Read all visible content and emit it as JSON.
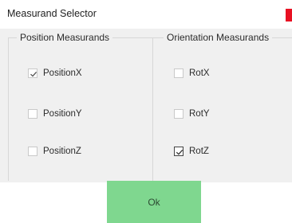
{
  "window": {
    "title": "Measurand Selector"
  },
  "position_group": {
    "title": "Position Measurands",
    "items": [
      {
        "label": "PositionX",
        "checked": true
      },
      {
        "label": "PositionY",
        "checked": false
      },
      {
        "label": "PositionZ",
        "checked": false
      }
    ]
  },
  "orientation_group": {
    "title": "Orientation Measurands",
    "items": [
      {
        "label": "RotX",
        "checked": false
      },
      {
        "label": "RotY",
        "checked": false
      },
      {
        "label": "RotZ",
        "checked": true
      }
    ]
  },
  "footer": {
    "ok_label": "Ok"
  },
  "colors": {
    "ok_button": "#7fd78f",
    "close_button": "#e81123",
    "panel_background": "#f0f0f0"
  }
}
